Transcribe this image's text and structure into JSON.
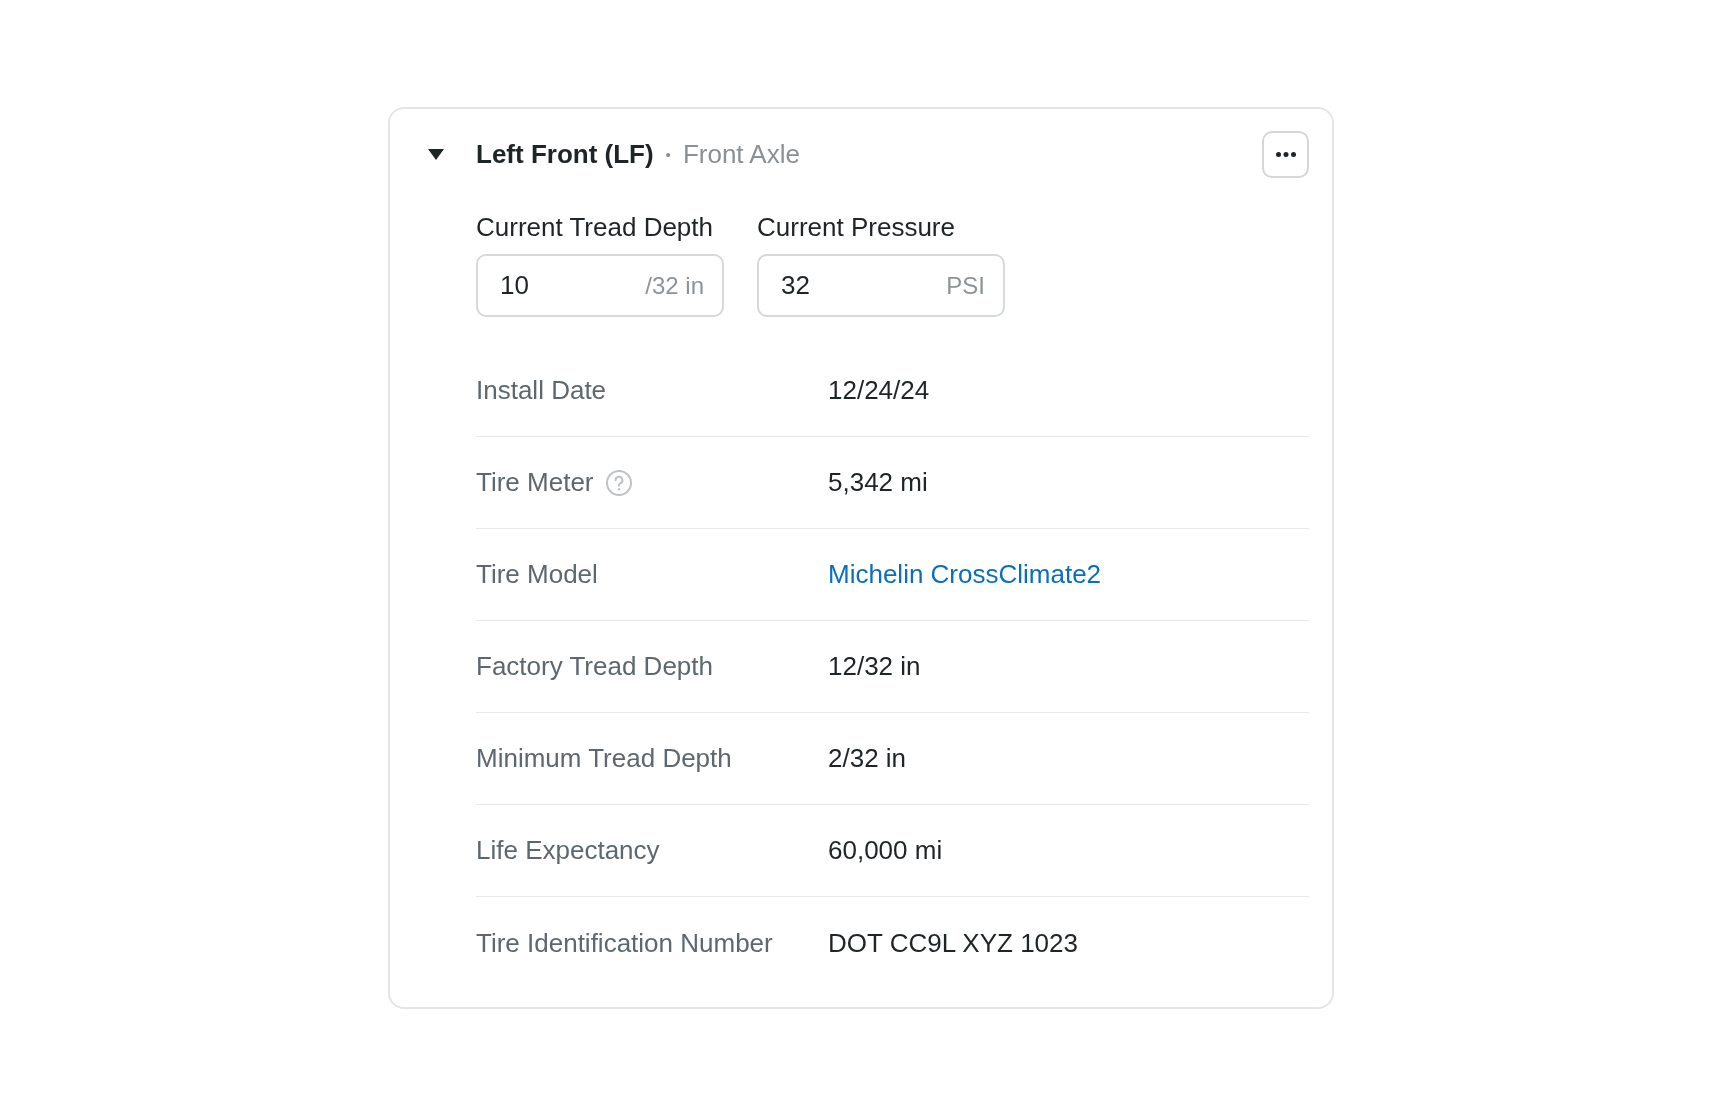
{
  "panel": {
    "expanded": true,
    "title": "Left Front (LF)",
    "separator": "•",
    "subtitle": "Front Axle",
    "fields": [
      {
        "label": "Current Tread Depth",
        "value": "10",
        "unit": "/32 in"
      },
      {
        "label": "Current Pressure",
        "value": "32",
        "unit": "PSI"
      }
    ],
    "details": [
      {
        "kind": "text",
        "label": "Install Date",
        "value": "12/24/24",
        "help": false
      },
      {
        "kind": "text",
        "label": "Tire Meter",
        "value": "5,342 mi",
        "help": true
      },
      {
        "kind": "link",
        "label": "Tire Model",
        "value": "Michelin CrossClimate2",
        "help": false
      },
      {
        "kind": "text",
        "label": "Factory Tread Depth",
        "value": "12/32 in",
        "help": false
      },
      {
        "kind": "text",
        "label": "Minimum Tread Depth",
        "value": "2/32 in",
        "help": false
      },
      {
        "kind": "text",
        "label": "Life Expectancy",
        "value": "60,000 mi",
        "help": false
      },
      {
        "kind": "text",
        "label": "Tire Identification Number",
        "value": "DOT CC9L XYZ 1023",
        "help": false
      }
    ]
  }
}
